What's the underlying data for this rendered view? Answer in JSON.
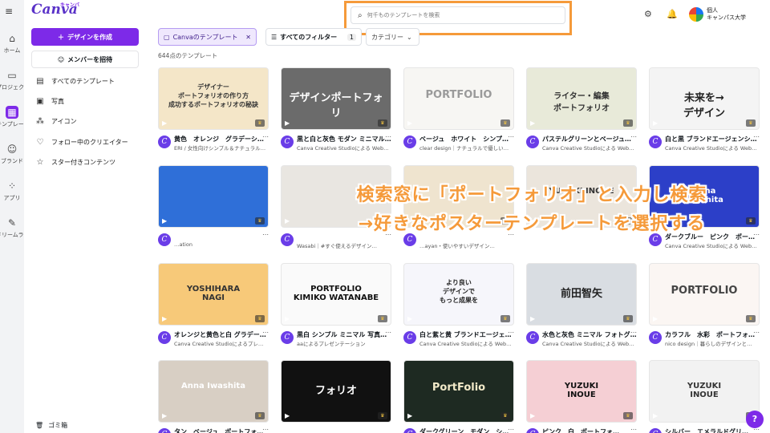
{
  "rail": {
    "items": [
      {
        "label": "ホーム",
        "icon": "home-icon"
      },
      {
        "label": "プロジェクト",
        "icon": "folder-icon"
      },
      {
        "label": "テンプレート",
        "icon": "template-icon"
      },
      {
        "label": "ブランド",
        "icon": "brand-icon"
      },
      {
        "label": "アプリ",
        "icon": "apps-icon"
      },
      {
        "label": "ドリームラボ",
        "icon": "dream-lab-icon"
      }
    ]
  },
  "sidebar": {
    "logo": "Canva",
    "logo_sub": "キャンバ",
    "create_label": "デザインを作成",
    "invite_label": "メンバーを招待",
    "items": [
      {
        "label": "すべてのテンプレート"
      },
      {
        "label": "写真"
      },
      {
        "label": "アイコン"
      },
      {
        "label": "フォロー中のクリエイター"
      },
      {
        "label": "スター付きコンテンツ"
      }
    ],
    "trash_label": "ゴミ箱"
  },
  "search": {
    "placeholder": "何千ものテンプレートを検索"
  },
  "account": {
    "line1": "個人",
    "line2": "キャンパス大学"
  },
  "filters": {
    "chip1": "Canvaのテンプレート",
    "chip2": "すべてのフィルター",
    "chip2_count": "1",
    "chip3": "カテゴリー"
  },
  "result_count": "644点のテンプレート",
  "overlay": {
    "line1": "検索窓に「ポートフォリオ」と入力し検索",
    "line2": "→好きなポスターテンプレートを選択する"
  },
  "cards": [
    {
      "title": "黄色　オレンジ　グラデーシ…",
      "by": "ERI / 女性向けシンプル＆ナチュラル…",
      "thumb_text": "デザイナー\nポートフォリオの作り方\n成功するポートフォリオの秘訣",
      "bg": "#f4e6c8",
      "fg": "#333"
    },
    {
      "title": "黒と白と灰色 モダン ミニマル…",
      "by": "Canva Creative Studioによる Web…",
      "thumb_text": "デザインポートフォリ",
      "bg": "#6b6b6b",
      "fg": "#fff"
    },
    {
      "title": "ベージュ　ホワイト　シンプ…",
      "by": "clear design｜ナチュラルで優しい…",
      "thumb_text": "PORTFOLIO",
      "bg": "#f7f6f3",
      "fg": "#9a9a9a"
    },
    {
      "title": "パステルグリーンとベージュ…",
      "by": "Canva Creative Studioによる Web…",
      "thumb_text": "ライター・編集\nポートフォリオ",
      "bg": "#e8ead9",
      "fg": "#333"
    },
    {
      "title": "白と黒 ブランドエージェンシ…",
      "by": "Canva Creative Studioによる Web…",
      "thumb_text": "未来を→\nデザイン",
      "bg": "#f4f4f4",
      "fg": "#222"
    },
    {
      "title": "",
      "by": "…ation",
      "thumb_text": "",
      "bg": "#2f6fd8",
      "fg": "#fff"
    },
    {
      "title": "",
      "by": "Wasabi｜#すぐ使えるデザイン…",
      "thumb_text": "",
      "bg": "#e9e6e1",
      "fg": "#555"
    },
    {
      "title": "",
      "by": "…ayan・使いやすいデザイン…",
      "thumb_text": "",
      "bg": "#efe4cf",
      "fg": "#6b5b3a"
    },
    {
      "title": "",
      "by": "",
      "thumb_text": "YUZUKI INOUE",
      "bg": "#ebe5dc",
      "fg": "#333"
    },
    {
      "title": "ダークブルー　ピンク　ポー…",
      "by": "Canva Creative Studioによる Web…",
      "thumb_text": "Anna\nIwashita",
      "bg": "#2c3fc8",
      "fg": "#fff"
    },
    {
      "title": "オレンジと黄色と白 グラデー…",
      "by": "Canva Creative Studioによるプレ…",
      "thumb_text": "YOSHIHARA\nNAGI",
      "bg": "#f7c979",
      "fg": "#333"
    },
    {
      "title": "黒白 シンプル ミニマル 写真…",
      "by": "aaによるプレゼンテーション",
      "thumb_text": "PORTFOLIO\nKIMIKO WATANABE",
      "bg": "#fafafa",
      "fg": "#111"
    },
    {
      "title": "白と紫と黄 ブランドエージェ…",
      "by": "Canva Creative Studioによる Web…",
      "thumb_text": "より良い\nデザインで\nもっと成果を",
      "bg": "#f6f6fb",
      "fg": "#222"
    },
    {
      "title": "水色と灰色 ミニマル フォトグ…",
      "by": "Canva Creative Studioによる Web…",
      "thumb_text": "前田智矢",
      "bg": "#d9dde2",
      "fg": "#222"
    },
    {
      "title": "カラフル　水彩　ポートフォ…",
      "by": "nico design｜暮らしのデザインと…",
      "thumb_text": "PORTFOLIO",
      "bg": "#fbf6f3",
      "fg": "#444"
    },
    {
      "title": "タン　ベージュ　ポートフォ…",
      "by": "",
      "thumb_text": "Anna Iwashita",
      "bg": "#d8cfc4",
      "fg": "#fff"
    },
    {
      "title": "",
      "by": "",
      "thumb_text": "フォリオ",
      "bg": "#111111",
      "fg": "#fff"
    },
    {
      "title": "ダークグリーン　モダン　シ…",
      "by": "",
      "thumb_text": "PortFolio",
      "bg": "#1e2a22",
      "fg": "#f1e9c8"
    },
    {
      "title": "ピンク　白　ポートフォ…",
      "by": "",
      "thumb_text": "YUZUKI\nINOUE",
      "bg": "#f5cfd4",
      "fg": "#111"
    },
    {
      "title": "シルバー　エメラルドグリ…",
      "by": "",
      "thumb_text": "YUZUKI\nINOUE",
      "bg": "#f2f2f2",
      "fg": "#333"
    }
  ],
  "help_label": "?"
}
